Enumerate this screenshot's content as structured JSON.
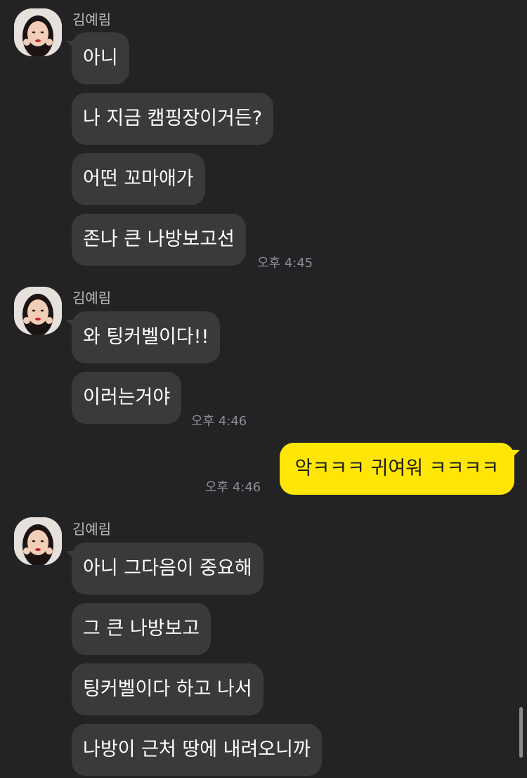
{
  "chat": {
    "sender_name": "김예림",
    "avatar_icon": "profile-photo-woman",
    "groups": [
      {
        "messages": [
          "아니",
          "나 지금 캠핑장이거든?",
          "어떤 꼬마애가",
          "존나 큰 나방보고선"
        ],
        "time": "오후 4:45"
      },
      {
        "messages": [
          "와 팅커벨이다!!",
          "이러는거야"
        ],
        "time": "오후 4:46"
      },
      {
        "messages": [
          "아니 그다음이 중요해",
          "그 큰 나방보고",
          "팅커벨이다 하고 나서",
          "나방이 근처 땅에 내려오니까"
        ]
      }
    ],
    "my_message": {
      "text": "악ㅋㅋㅋ 귀여워 ㅋㅋㅋㅋ",
      "time": "오후 4:46"
    }
  },
  "colors": {
    "background": "#232326",
    "incoming_bubble": "#3a3a3d",
    "outgoing_bubble": "#ffe606"
  }
}
